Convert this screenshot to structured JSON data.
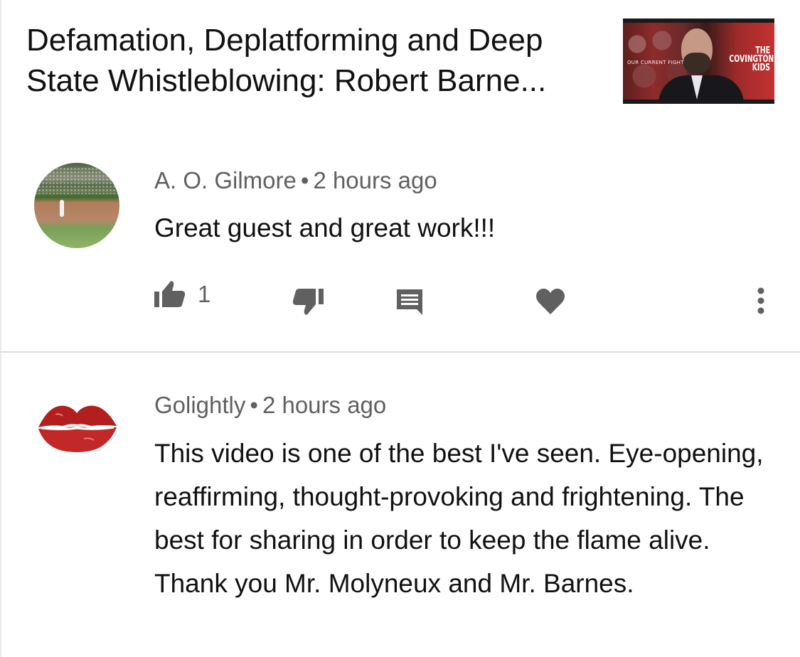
{
  "video": {
    "title": "Defamation, Deplatforming and Deep State Whistleblowing: Robert Barne...",
    "thumbnail": {
      "left_text": "OUR CURRENT FIGHT",
      "right_text_line1": "THE",
      "right_text_line2": "COVINGTON",
      "right_text_line3": "KIDS"
    }
  },
  "comments": [
    {
      "author": "A. O. Gilmore",
      "separator": "•",
      "time": "2 hours ago",
      "text": "Great guest and great work!!!",
      "likes": "1",
      "avatar": "baseball-stadium-avatar",
      "actions": {
        "like_icon": "thumb-up-icon",
        "dislike_icon": "thumb-down-icon",
        "reply_icon": "reply-comment-icon",
        "heart_icon": "heart-icon",
        "more_icon": "more-vertical-icon"
      }
    },
    {
      "author": "Golightly",
      "separator": "•",
      "time": "2 hours ago",
      "text": "This video is one of the best I've seen. Eye-opening, reaffirming, thought-provoking and frightening. The best for sharing in order to keep the flame alive. Thank you Mr. Molyneux and Mr. Barnes.",
      "avatar": "red-lips-avatar"
    }
  ],
  "colors": {
    "icon_gray": "#606060",
    "text_primary": "#111111",
    "text_secondary": "#606060",
    "divider": "#dedede"
  }
}
